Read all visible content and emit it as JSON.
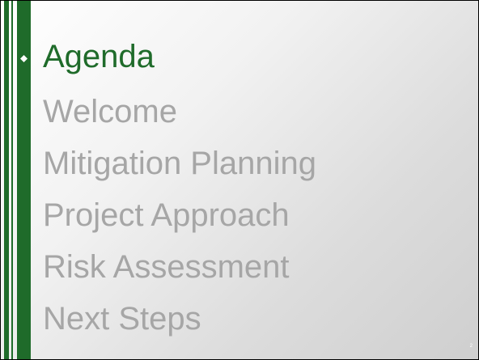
{
  "slide": {
    "title": "Agenda",
    "items": [
      "Welcome",
      "Mitigation Planning",
      "Project Approach",
      "Risk Assessment",
      "Next Steps"
    ],
    "page_number": "2",
    "bullet_icon": "diamond-bullet",
    "colors": {
      "accent": "#1f6b2a",
      "muted_text": "#a6a6a6"
    }
  }
}
